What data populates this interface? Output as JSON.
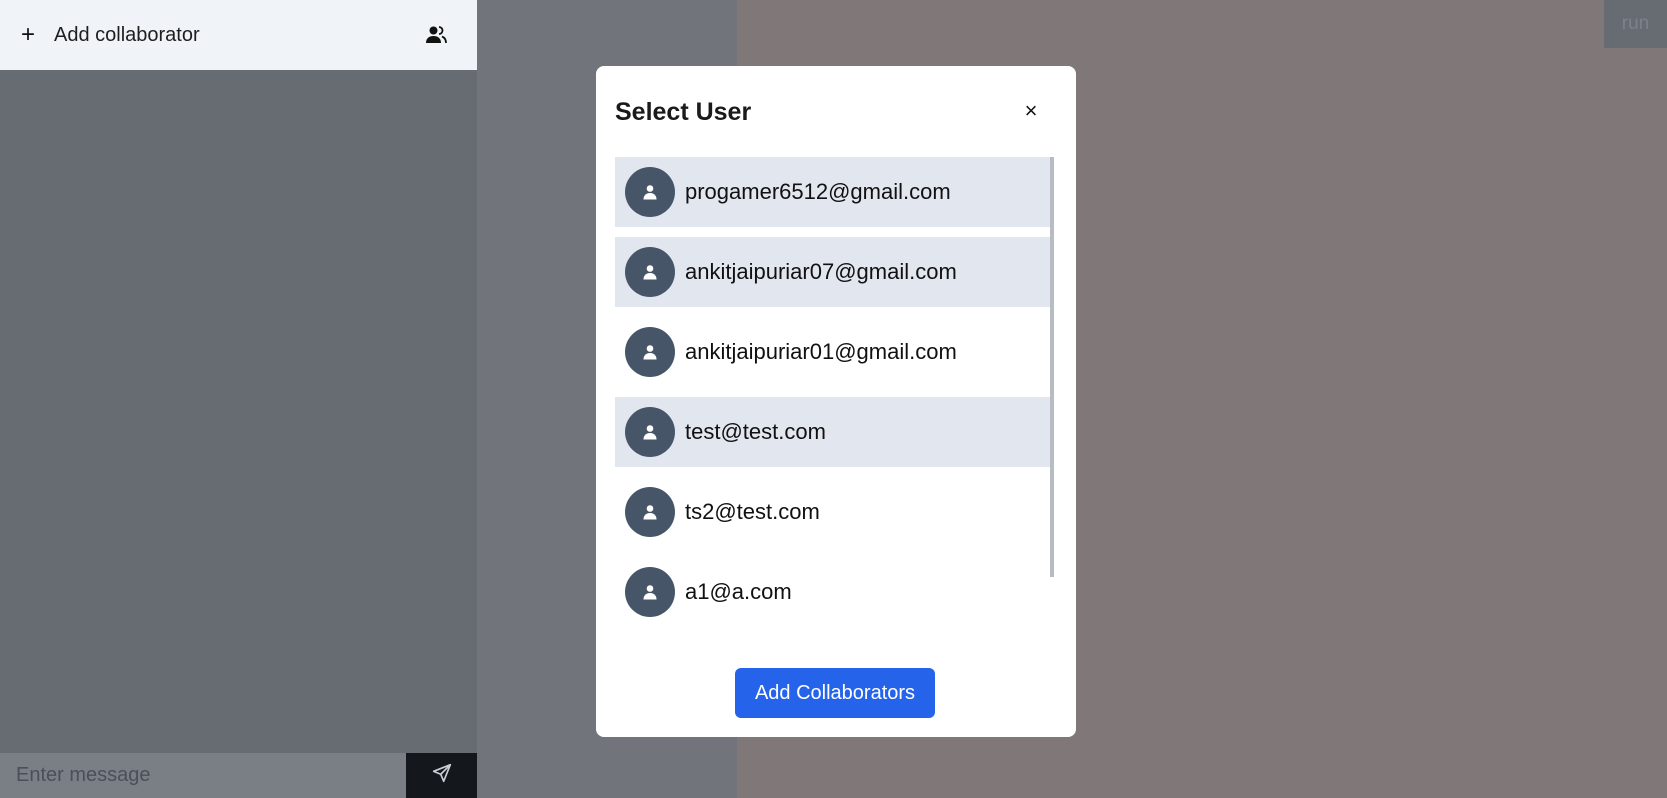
{
  "left_panel": {
    "add_collaborator_label": "Add collaborator",
    "message_placeholder": "Enter message"
  },
  "top_right": {
    "run_label": "run"
  },
  "modal": {
    "title": "Select User",
    "close_symbol": "×",
    "users": [
      {
        "email": "progamer6512@gmail.com",
        "selected": true
      },
      {
        "email": "ankitjaipuriar07@gmail.com",
        "selected": true
      },
      {
        "email": "ankitjaipuriar01@gmail.com",
        "selected": false
      },
      {
        "email": "test@test.com",
        "selected": true
      },
      {
        "email": "ts2@test.com",
        "selected": false
      },
      {
        "email": "a1@a.com",
        "selected": false
      }
    ],
    "submit_label": "Add Collaborators"
  },
  "colors": {
    "primary": "#2563eb",
    "avatar_bg": "#475569",
    "selected_row": "#e2e7ef"
  }
}
